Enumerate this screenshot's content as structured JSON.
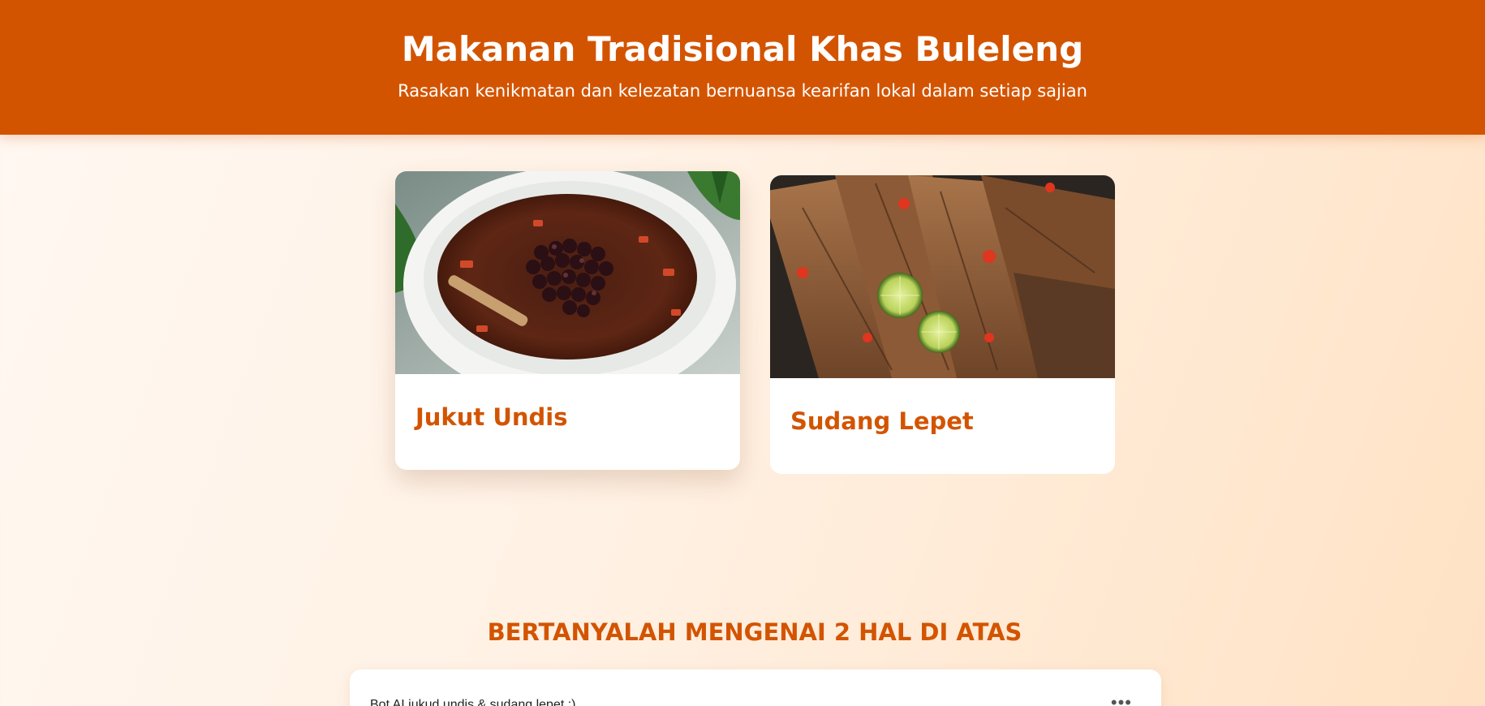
{
  "header": {
    "title": "Makanan Tradisional Khas Buleleng",
    "subtitle": "Rasakan kenikmatan dan kelezatan bernuansa kearifan lokal dalam setiap sajian"
  },
  "cards": [
    {
      "title": "Jukut Undis",
      "image": "black-bean-soup-photo"
    },
    {
      "title": "Sudang Lepet",
      "image": "dried-fish-lime-photo"
    }
  ],
  "chat": {
    "heading": "BERTANYALAH MENGENAI 2 HAL DI ATAS",
    "message": "Bot AI jukud undis & sudang lepet :)",
    "menu_icon": "more-dots-icon"
  },
  "colors": {
    "brand": "#d35400",
    "background_start": "#fff8f2",
    "background_end": "#ffe2c4"
  }
}
